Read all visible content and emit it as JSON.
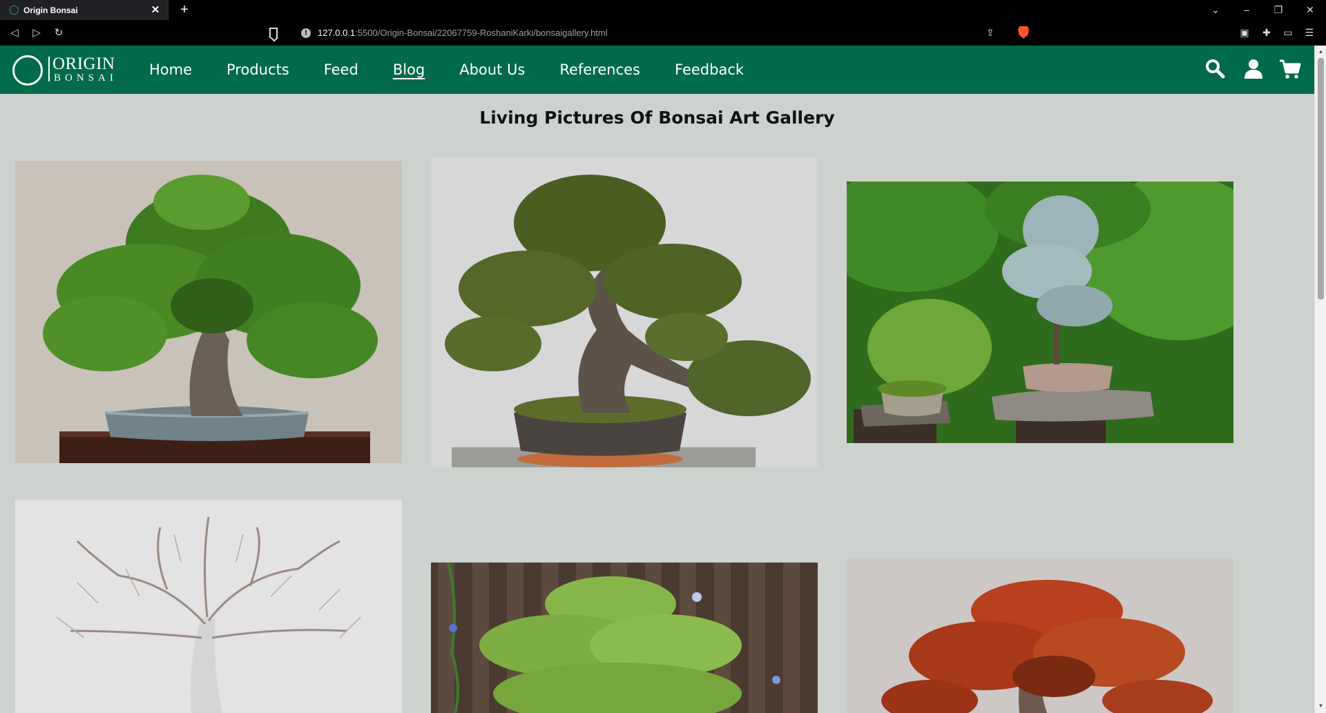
{
  "browser": {
    "tab_title": "Origin Bonsai",
    "url_host": "127.0.0.1",
    "url_rest": ":5500/Origin-Bonsai/22067759-RoshaniKarki/bonsaigallery.html"
  },
  "site": {
    "logo_top": "ORIGIN",
    "logo_bottom": "BONSAI",
    "nav": [
      {
        "label": "Home"
      },
      {
        "label": "Products"
      },
      {
        "label": "Feed"
      },
      {
        "label": "Blog"
      },
      {
        "label": "About Us"
      },
      {
        "label": "References"
      },
      {
        "label": "Feedback"
      }
    ],
    "active_nav": "Blog",
    "header_color": "#006a4a"
  },
  "gallery": {
    "title": "Living Pictures Of Bonsai Art Gallery",
    "images": [
      {
        "name": "bonsai-broadleaf-green",
        "alt": ""
      },
      {
        "name": "bonsai-pine-cascade",
        "alt": ""
      },
      {
        "name": "bonsai-garden-display",
        "alt": ""
      },
      {
        "name": "bonsai-winter-bare",
        "alt": ""
      },
      {
        "name": "bonsai-pine-fence",
        "alt": ""
      },
      {
        "name": "bonsai-red-maple",
        "alt": ""
      }
    ]
  }
}
